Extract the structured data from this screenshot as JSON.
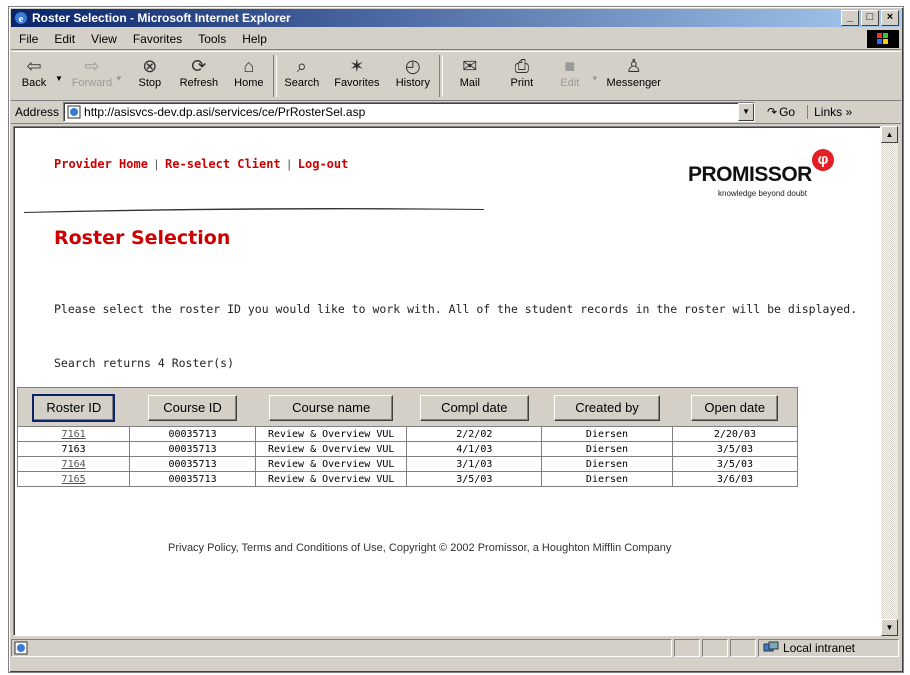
{
  "window": {
    "title": "Roster Selection - Microsoft Internet Explorer"
  },
  "menu": [
    "File",
    "Edit",
    "View",
    "Favorites",
    "Tools",
    "Help"
  ],
  "toolbar": {
    "back": "Back",
    "forward": "Forward",
    "stop": "Stop",
    "refresh": "Refresh",
    "home": "Home",
    "search": "Search",
    "favorites": "Favorites",
    "history": "History",
    "mail": "Mail",
    "print": "Print",
    "edit": "Edit",
    "messenger": "Messenger"
  },
  "address": {
    "label": "Address",
    "url": "http://asisvcs-dev.dp.asi/services/ce/PrRosterSel.asp",
    "go": "Go",
    "links": "Links"
  },
  "nav": {
    "provider_home": "Provider Home",
    "reselect_client": "Re-select Client",
    "logout": "Log-out"
  },
  "logo": {
    "name": "PROMISSOR",
    "tagline": "knowledge beyond doubt"
  },
  "page": {
    "title": "Roster Selection",
    "intro": "Please select the roster ID you would like to work with. All of the student records in the roster will be displayed.",
    "count": "Search returns 4 Roster(s)"
  },
  "table": {
    "headers": [
      "Roster ID",
      "Course ID",
      "Course name",
      "Compl date",
      "Created by",
      "Open date"
    ],
    "rows": [
      {
        "roster_id": "7161",
        "course_id": "00035713",
        "course_name": "Review & Overview VUL",
        "compl_date": "2/2/02",
        "created_by": "Diersen",
        "open_date": "2/20/03"
      },
      {
        "roster_id": "7163",
        "course_id": "00035713",
        "course_name": "Review & Overview VUL",
        "compl_date": "4/1/03",
        "created_by": "Diersen",
        "open_date": "3/5/03"
      },
      {
        "roster_id": "7164",
        "course_id": "00035713",
        "course_name": "Review & Overview VUL",
        "compl_date": "3/1/03",
        "created_by": "Diersen",
        "open_date": "3/5/03"
      },
      {
        "roster_id": "7165",
        "course_id": "00035713",
        "course_name": "Review & Overview VUL",
        "compl_date": "3/5/03",
        "created_by": "Diersen",
        "open_date": "3/6/03"
      }
    ]
  },
  "footer": "Privacy Policy, Terms and Conditions of Use,  Copyright © 2002 Promissor,  a Houghton Mifflin Company",
  "status": {
    "zone": "Local intranet"
  },
  "colors": {
    "accent": "#cc0000",
    "titlebar": "#0a246a",
    "chrome": "#d4d0c8"
  }
}
